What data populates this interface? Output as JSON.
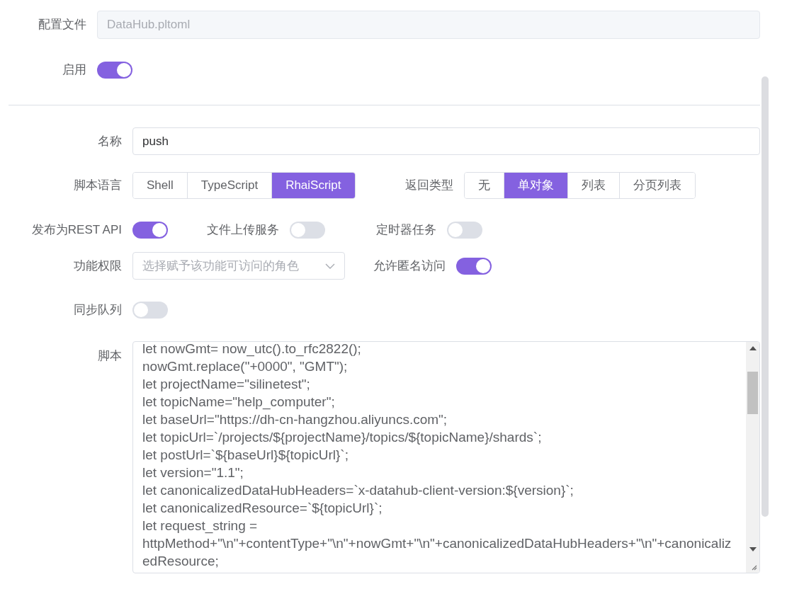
{
  "config_file": {
    "label": "配置文件",
    "value": "DataHub.pltoml",
    "disabled": true
  },
  "enabled": {
    "label": "启用",
    "on": true
  },
  "name": {
    "label": "名称",
    "value": "push"
  },
  "script_language": {
    "label": "脚本语言",
    "options": [
      {
        "label": "Shell",
        "selected": false
      },
      {
        "label": "TypeScript",
        "selected": false
      },
      {
        "label": "RhaiScript",
        "selected": true
      }
    ]
  },
  "return_type": {
    "label": "返回类型",
    "options": [
      {
        "label": "无",
        "selected": false
      },
      {
        "label": "单对象",
        "selected": true
      },
      {
        "label": "列表",
        "selected": false
      },
      {
        "label": "分页列表",
        "selected": false
      }
    ]
  },
  "toggles": [
    {
      "label": "发布为REST API",
      "on": true
    },
    {
      "label": "文件上传服务",
      "on": false
    },
    {
      "label": "定时器任务",
      "on": false
    }
  ],
  "permissions": {
    "label": "功能权限",
    "placeholder": "选择赋予该功能可访问的角色"
  },
  "anonymous_access": {
    "label": "允许匿名访问",
    "on": true
  },
  "sync_queue": {
    "label": "同步队列",
    "on": false
  },
  "script": {
    "label": "脚本",
    "lines": [
      "let nowGmt= now_utc().to_rfc2822();",
      "nowGmt.replace(\"+0000\", \"GMT\");",
      "let projectName=\"silinetest\";",
      "let topicName=\"help_computer\";",
      "let baseUrl=\"https://dh-cn-hangzhou.aliyuncs.com\";",
      "let topicUrl=`/projects/${projectName}/topics/${topicName}/shards`;",
      "let postUrl=`${baseUrl}${topicUrl}`;",
      "let version=\"1.1\";",
      "let canonicalizedDataHubHeaders=`x-datahub-client-version:${version}`;",
      "let canonicalizedResource=`${topicUrl}`;",
      "let request_string =",
      "httpMethod+\"\\n\"+contentType+\"\\n\"+nowGmt+\"\\n\"+canonicalizedDataHubHeaders+\"\\n\"+canonicalizedResource;"
    ]
  }
}
